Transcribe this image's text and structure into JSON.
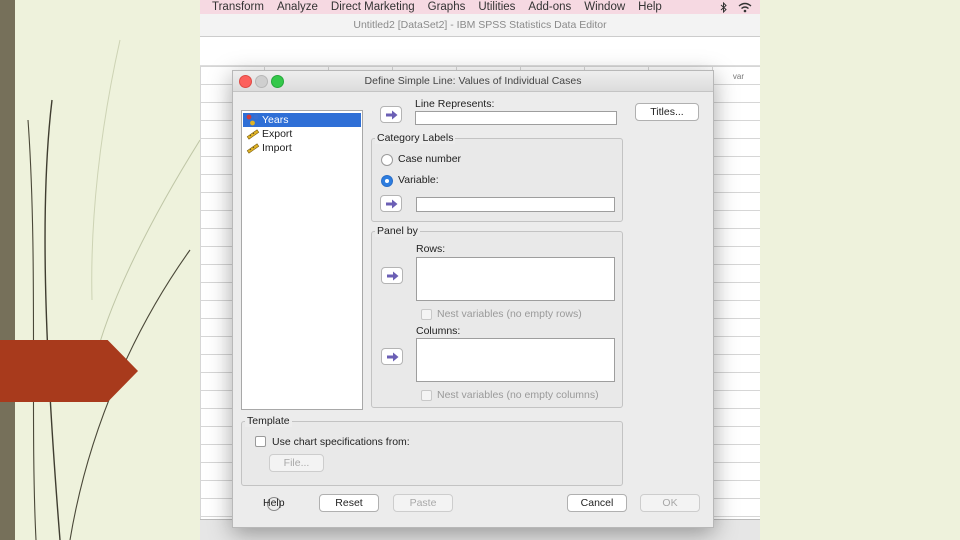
{
  "menubar": {
    "items": [
      "Transform",
      "Analyze",
      "Direct Marketing",
      "Graphs",
      "Utilities",
      "Add-ons",
      "Window",
      "Help"
    ],
    "icons": [
      "bluetooth-icon",
      "wifi-icon"
    ]
  },
  "app_title": "Untitled2 [DataSet2] - IBM SPSS Statistics Data Editor",
  "grid": {
    "column_header": "var"
  },
  "dialog": {
    "title": "Define Simple Line: Values of Individual Cases",
    "variables": [
      {
        "label": "Years",
        "icon": "nominal-variable-icon",
        "selected": true
      },
      {
        "label": "Export",
        "icon": "scale-variable-icon",
        "selected": false
      },
      {
        "label": "Import",
        "icon": "scale-variable-icon",
        "selected": false
      }
    ],
    "line_represents_label": "Line Represents:",
    "line_represents_value": "",
    "titles_button": "Titles...",
    "category_labels": {
      "title": "Category Labels",
      "option_case_number": "Case number",
      "option_variable": "Variable:",
      "selected": "Variable:",
      "variable_value": ""
    },
    "panel_by": {
      "title": "Panel by",
      "rows_label": "Rows:",
      "nest_rows": "Nest variables (no empty rows)",
      "columns_label": "Columns:",
      "nest_columns": "Nest variables (no empty columns)"
    },
    "template": {
      "title": "Template",
      "use_spec": "Use chart specifications from:",
      "file_button": "File..."
    },
    "buttons": {
      "help": "Help",
      "reset": "Reset",
      "paste": "Paste",
      "cancel": "Cancel",
      "ok": "OK"
    }
  },
  "colors": {
    "accent": "#2d7de0",
    "selection": "#2f6fd6",
    "arrow": "#6b5fb5",
    "slide_background": "#eef2dc",
    "slide_bar": "#76705a",
    "slide_marker": "#a83a1c",
    "menubar": "#f6d9e2"
  }
}
